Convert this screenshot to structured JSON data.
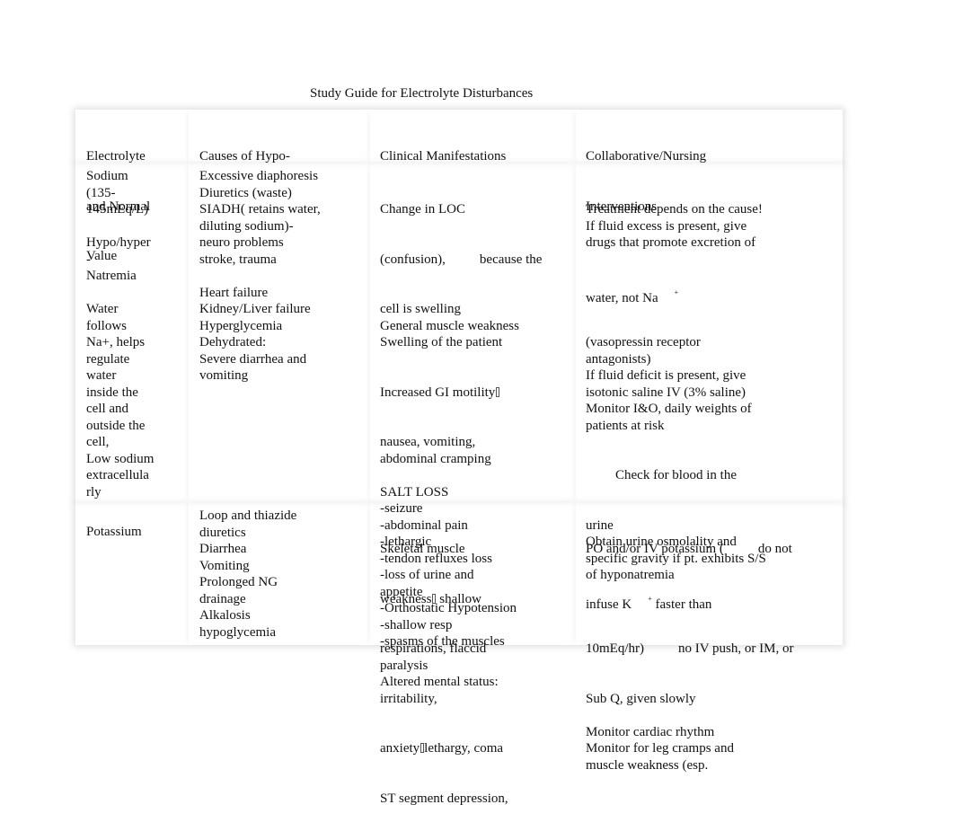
{
  "document": {
    "title": "Study Guide for Electrolyte Disturbances"
  },
  "table": {
    "headers": [
      [
        "Electrolyte",
        "and Normal",
        "Value"
      ],
      [
        "Causes of Hypo-"
      ],
      [
        "Clinical Manifestations"
      ],
      [
        "Collaborative/Nursing",
        "Interventions"
      ]
    ],
    "rows": [
      {
        "electrolyte": [
          "Sodium",
          "(135-",
          "145mEq/L)",
          "",
          "Hypo/hyper",
          "-",
          "Natremia",
          "",
          "Water",
          "follows",
          "Na+, helps",
          "regulate",
          "water",
          "inside the",
          "cell and",
          "outside the",
          "cell,",
          "Low sodium",
          "extracellula",
          "rly"
        ],
        "causes": [
          "Excessive diaphoresis",
          "Diuretics (waste)",
          "SIADH( retains water,",
          "diluting sodium)-",
          "neuro problems",
          "stroke, trauma",
          "",
          "Heart failure",
          "Kidney/Liver failure",
          "Hyperglycemia",
          "Dehydrated:",
          "Severe diarrhea and",
          "vomiting"
        ],
        "manifestations": {
          "line1": "Change in LOC",
          "line2a": "(confusion),",
          "line2b": "because the",
          "lines": [
            "cell is swelling",
            "General muscle weakness",
            "Swelling of the patient"
          ],
          "gi_line": "Increased GI motility",
          "lines_after": [
            "nausea, vomiting,",
            "abdominal cramping",
            "",
            "SALT LOSS",
            "-seizure",
            "-abdominal pain",
            "-lethargic",
            "-tendon refluxes loss",
            "-loss of urine and",
            "appetite",
            "-Orthostatic Hypotension",
            "-shallow resp",
            "-spasms of the muscles"
          ]
        },
        "interventions": {
          "lines_before": [
            "Treatment depends on the cause!",
            "If fluid excess is present, give",
            "drugs that promote excretion of"
          ],
          "water_line": "water, not Na",
          "superscript": "+",
          "lines_mid": [
            "(vasopressin receptor",
            "antagonists)",
            "If fluid deficit is present, give",
            "isotonic saline IV (3% saline)",
            "Monitor I&O, daily weights of",
            "patients at risk"
          ],
          "indented_line": "Check for blood in the",
          "lines_after": [
            "urine",
            "Obtain urine osmolality and",
            "specific gravity if pt. exhibits S/S",
            "of hyponatremia"
          ]
        }
      },
      {
        "electrolyte": [
          "Potassium"
        ],
        "causes": [
          "Loop and thiazide",
          "diuretics",
          "Diarrhea",
          "Vomiting",
          "Prolonged NG",
          "drainage",
          "Alkalosis",
          "hypoglycemia"
        ],
        "manifestations": {
          "line1": "Skeletal muscle",
          "line2a": "weakness",
          "line2b": " shallow",
          "lines_mid": [
            "respirations, flaccid",
            "paralysis",
            "Altered mental status:",
            "irritability,"
          ],
          "anx_a": "anxiety",
          "anx_b": "lethargy, coma",
          "lines_after": [
            "ST segment depression,"
          ]
        },
        "interventions": {
          "line1a": "PO and/or IV potassium (",
          "line1b": "do not",
          "line2a": "infuse K",
          "superscript": "+",
          "line2b": " faster than",
          "line3a": "10mEq/hr)",
          "line3b": "no IV push, or IM, or",
          "lines_after": [
            "Sub Q, given slowly",
            "",
            "Monitor cardiac rhythm",
            "Monitor for leg cramps and",
            "muscle weakness (esp."
          ]
        }
      }
    ]
  }
}
